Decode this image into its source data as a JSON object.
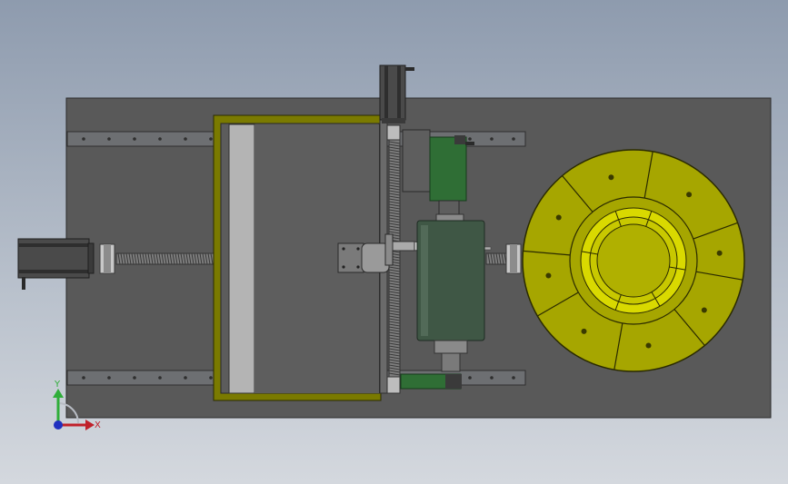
{
  "viewport": {
    "background_top": "#8e9bae",
    "background_bottom": "#d4d8de"
  },
  "colors": {
    "base_plate": "#595959",
    "rail": "#6d6f72",
    "frame_olive": "#7a7a00",
    "disc_yellow": "#a6a600",
    "ring_bright": "#d9d900",
    "motor_green": "#2f6e35",
    "roller_green": "#3f5745",
    "steel": "#9a9a9a",
    "dark_steel": "#4a4a4a"
  },
  "triad": {
    "y_label": "Y",
    "x_label": "X",
    "y_color": "#2fae3a",
    "x_color": "#c0202a",
    "z_color": "#2030c0"
  }
}
